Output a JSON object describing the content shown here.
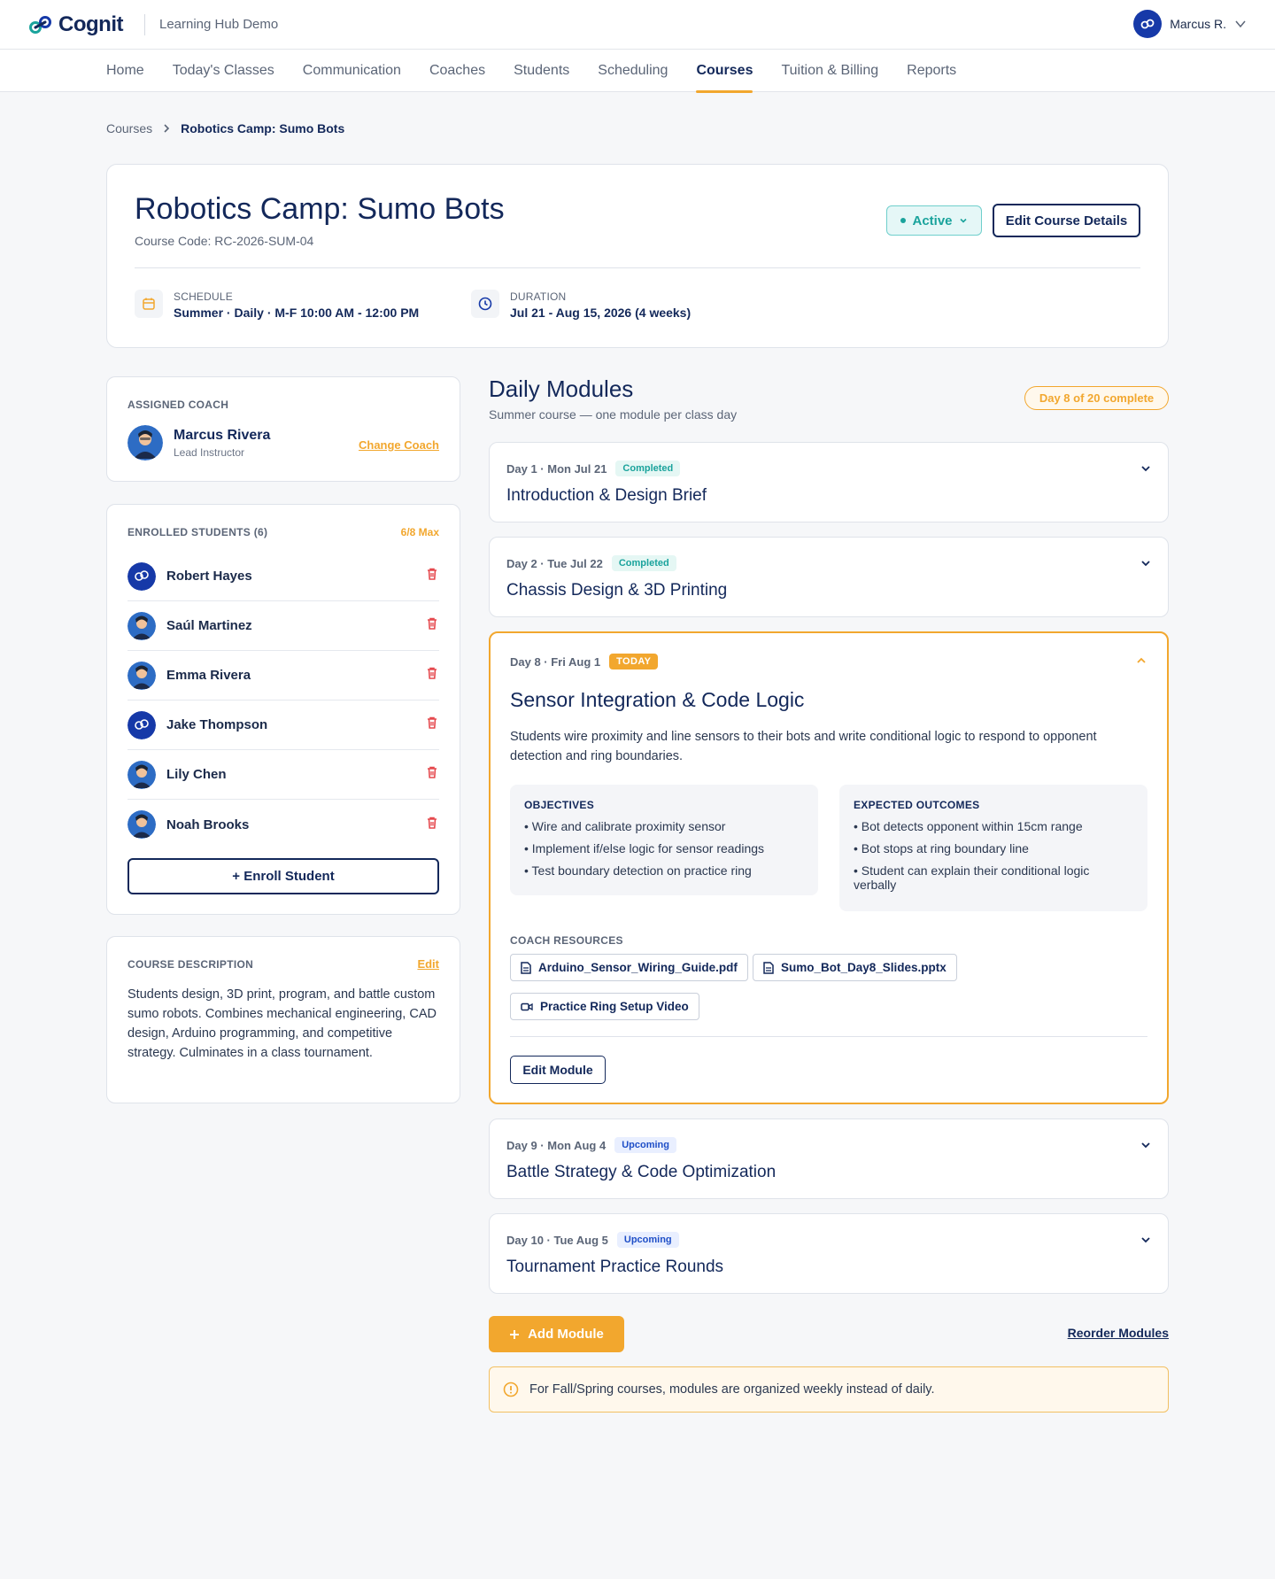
{
  "brand": {
    "name": "Cognit",
    "hub": "Learning Hub Demo",
    "accent": "#f2a72e",
    "navy": "#13285a",
    "teal": "#1aa39c"
  },
  "user": {
    "name": "Marcus R."
  },
  "nav": {
    "items": [
      "Home",
      "Today's Classes",
      "Communication",
      "Coaches",
      "Students",
      "Scheduling",
      "Courses",
      "Tuition & Billing",
      "Reports"
    ],
    "active": "Courses"
  },
  "breadcrumb": {
    "root": "Courses",
    "current": "Robotics Camp: Sumo Bots"
  },
  "course": {
    "title": "Robotics Camp: Sumo Bots",
    "code": "Course Code: RC-2026-SUM-04",
    "status": "Active",
    "edit_label": "Edit Course Details",
    "schedule_label": "SCHEDULE",
    "schedule_value": "Summer · Daily · M-F 10:00 AM - 12:00 PM",
    "duration_label": "DURATION",
    "duration_value": "Jul 21 - Aug 15, 2026 (4 weeks)"
  },
  "coach_panel": {
    "label": "ASSIGNED COACH",
    "name": "Marcus Rivera",
    "role": "Lead Instructor",
    "change_label": "Change Coach"
  },
  "students_panel": {
    "label": "ENROLLED STUDENTS (6)",
    "max": "6/8 Max",
    "enroll_label": "+ Enroll Student",
    "students": [
      {
        "name": "Robert Hayes",
        "avatar": "logo"
      },
      {
        "name": "Saúl Martinez",
        "avatar": "person"
      },
      {
        "name": "Emma Rivera",
        "avatar": "person"
      },
      {
        "name": "Jake Thompson",
        "avatar": "logo"
      },
      {
        "name": "Lily Chen",
        "avatar": "person"
      },
      {
        "name": "Noah Brooks",
        "avatar": "person"
      }
    ]
  },
  "description_panel": {
    "label": "COURSE DESCRIPTION",
    "edit_label": "Edit",
    "text": "Students design, 3D print, program, and battle custom sumo robots. Combines mechanical engineering, CAD design, Arduino programming, and competitive strategy. Culminates in a class tournament."
  },
  "modules": {
    "title": "Daily Modules",
    "subtitle": "Summer course — one module per class day",
    "progress": "Day 8 of 20 complete",
    "items": [
      {
        "meta": "Day 1 · Mon Jul 21",
        "badge": "Completed",
        "title": "Introduction & Design Brief"
      },
      {
        "meta": "Day 2 · Tue Jul 22",
        "badge": "Completed",
        "title": "Chassis Design & 3D Printing"
      },
      {
        "meta": "Day 8 · Fri Aug 1",
        "badge": "TODAY",
        "title": "Sensor Integration & Code Logic"
      },
      {
        "meta": "Day 9 · Mon Aug 4",
        "badge": "Upcoming",
        "title": "Battle Strategy & Code Optimization"
      },
      {
        "meta": "Day 10 · Tue Aug 5",
        "badge": "Upcoming",
        "title": "Tournament Practice Rounds"
      }
    ],
    "expanded": {
      "description": "Students wire proximity and line sensors to their bots and write conditional logic to respond to opponent detection and ring boundaries.",
      "objectives_label": "OBJECTIVES",
      "objectives": [
        "• Wire and calibrate proximity sensor",
        "• Implement if/else logic for sensor readings",
        "• Test boundary detection on practice ring"
      ],
      "outcomes_label": "EXPECTED OUTCOMES",
      "outcomes": [
        "• Bot detects opponent within 15cm range",
        "• Bot stops at ring boundary line",
        "• Student can explain their conditional logic verbally"
      ],
      "resources_label": "COACH RESOURCES",
      "resources": [
        "Arduino_Sensor_Wiring_Guide.pdf",
        "Sumo_Bot_Day8_Slides.pptx",
        "Practice Ring Setup Video"
      ],
      "edit_label": "Edit Module"
    },
    "add_label": "Add Module",
    "reorder_label": "Reorder Modules",
    "info": "For Fall/Spring courses, modules are organized weekly instead of daily."
  }
}
